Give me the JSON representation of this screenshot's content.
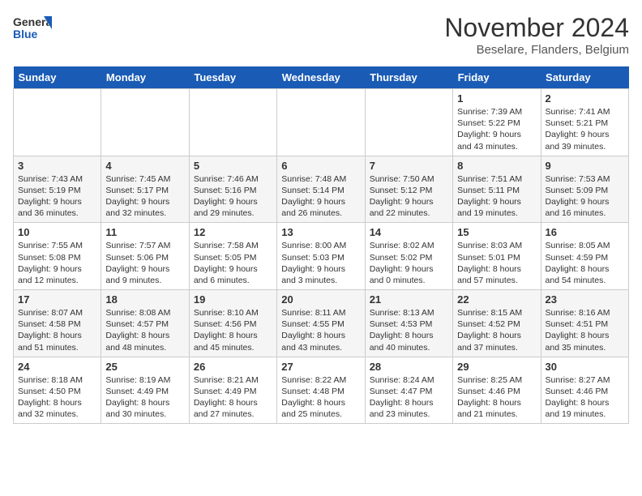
{
  "header": {
    "logo_line1": "General",
    "logo_line2": "Blue",
    "month": "November 2024",
    "location": "Beselare, Flanders, Belgium"
  },
  "days_of_week": [
    "Sunday",
    "Monday",
    "Tuesday",
    "Wednesday",
    "Thursday",
    "Friday",
    "Saturday"
  ],
  "weeks": [
    [
      {
        "day": "",
        "info": ""
      },
      {
        "day": "",
        "info": ""
      },
      {
        "day": "",
        "info": ""
      },
      {
        "day": "",
        "info": ""
      },
      {
        "day": "",
        "info": ""
      },
      {
        "day": "1",
        "info": "Sunrise: 7:39 AM\nSunset: 5:22 PM\nDaylight: 9 hours\nand 43 minutes."
      },
      {
        "day": "2",
        "info": "Sunrise: 7:41 AM\nSunset: 5:21 PM\nDaylight: 9 hours\nand 39 minutes."
      }
    ],
    [
      {
        "day": "3",
        "info": "Sunrise: 7:43 AM\nSunset: 5:19 PM\nDaylight: 9 hours\nand 36 minutes."
      },
      {
        "day": "4",
        "info": "Sunrise: 7:45 AM\nSunset: 5:17 PM\nDaylight: 9 hours\nand 32 minutes."
      },
      {
        "day": "5",
        "info": "Sunrise: 7:46 AM\nSunset: 5:16 PM\nDaylight: 9 hours\nand 29 minutes."
      },
      {
        "day": "6",
        "info": "Sunrise: 7:48 AM\nSunset: 5:14 PM\nDaylight: 9 hours\nand 26 minutes."
      },
      {
        "day": "7",
        "info": "Sunrise: 7:50 AM\nSunset: 5:12 PM\nDaylight: 9 hours\nand 22 minutes."
      },
      {
        "day": "8",
        "info": "Sunrise: 7:51 AM\nSunset: 5:11 PM\nDaylight: 9 hours\nand 19 minutes."
      },
      {
        "day": "9",
        "info": "Sunrise: 7:53 AM\nSunset: 5:09 PM\nDaylight: 9 hours\nand 16 minutes."
      }
    ],
    [
      {
        "day": "10",
        "info": "Sunrise: 7:55 AM\nSunset: 5:08 PM\nDaylight: 9 hours\nand 12 minutes."
      },
      {
        "day": "11",
        "info": "Sunrise: 7:57 AM\nSunset: 5:06 PM\nDaylight: 9 hours\nand 9 minutes."
      },
      {
        "day": "12",
        "info": "Sunrise: 7:58 AM\nSunset: 5:05 PM\nDaylight: 9 hours\nand 6 minutes."
      },
      {
        "day": "13",
        "info": "Sunrise: 8:00 AM\nSunset: 5:03 PM\nDaylight: 9 hours\nand 3 minutes."
      },
      {
        "day": "14",
        "info": "Sunrise: 8:02 AM\nSunset: 5:02 PM\nDaylight: 9 hours\nand 0 minutes."
      },
      {
        "day": "15",
        "info": "Sunrise: 8:03 AM\nSunset: 5:01 PM\nDaylight: 8 hours\nand 57 minutes."
      },
      {
        "day": "16",
        "info": "Sunrise: 8:05 AM\nSunset: 4:59 PM\nDaylight: 8 hours\nand 54 minutes."
      }
    ],
    [
      {
        "day": "17",
        "info": "Sunrise: 8:07 AM\nSunset: 4:58 PM\nDaylight: 8 hours\nand 51 minutes."
      },
      {
        "day": "18",
        "info": "Sunrise: 8:08 AM\nSunset: 4:57 PM\nDaylight: 8 hours\nand 48 minutes."
      },
      {
        "day": "19",
        "info": "Sunrise: 8:10 AM\nSunset: 4:56 PM\nDaylight: 8 hours\nand 45 minutes."
      },
      {
        "day": "20",
        "info": "Sunrise: 8:11 AM\nSunset: 4:55 PM\nDaylight: 8 hours\nand 43 minutes."
      },
      {
        "day": "21",
        "info": "Sunrise: 8:13 AM\nSunset: 4:53 PM\nDaylight: 8 hours\nand 40 minutes."
      },
      {
        "day": "22",
        "info": "Sunrise: 8:15 AM\nSunset: 4:52 PM\nDaylight: 8 hours\nand 37 minutes."
      },
      {
        "day": "23",
        "info": "Sunrise: 8:16 AM\nSunset: 4:51 PM\nDaylight: 8 hours\nand 35 minutes."
      }
    ],
    [
      {
        "day": "24",
        "info": "Sunrise: 8:18 AM\nSunset: 4:50 PM\nDaylight: 8 hours\nand 32 minutes."
      },
      {
        "day": "25",
        "info": "Sunrise: 8:19 AM\nSunset: 4:49 PM\nDaylight: 8 hours\nand 30 minutes."
      },
      {
        "day": "26",
        "info": "Sunrise: 8:21 AM\nSunset: 4:49 PM\nDaylight: 8 hours\nand 27 minutes."
      },
      {
        "day": "27",
        "info": "Sunrise: 8:22 AM\nSunset: 4:48 PM\nDaylight: 8 hours\nand 25 minutes."
      },
      {
        "day": "28",
        "info": "Sunrise: 8:24 AM\nSunset: 4:47 PM\nDaylight: 8 hours\nand 23 minutes."
      },
      {
        "day": "29",
        "info": "Sunrise: 8:25 AM\nSunset: 4:46 PM\nDaylight: 8 hours\nand 21 minutes."
      },
      {
        "day": "30",
        "info": "Sunrise: 8:27 AM\nSunset: 4:46 PM\nDaylight: 8 hours\nand 19 minutes."
      }
    ]
  ]
}
